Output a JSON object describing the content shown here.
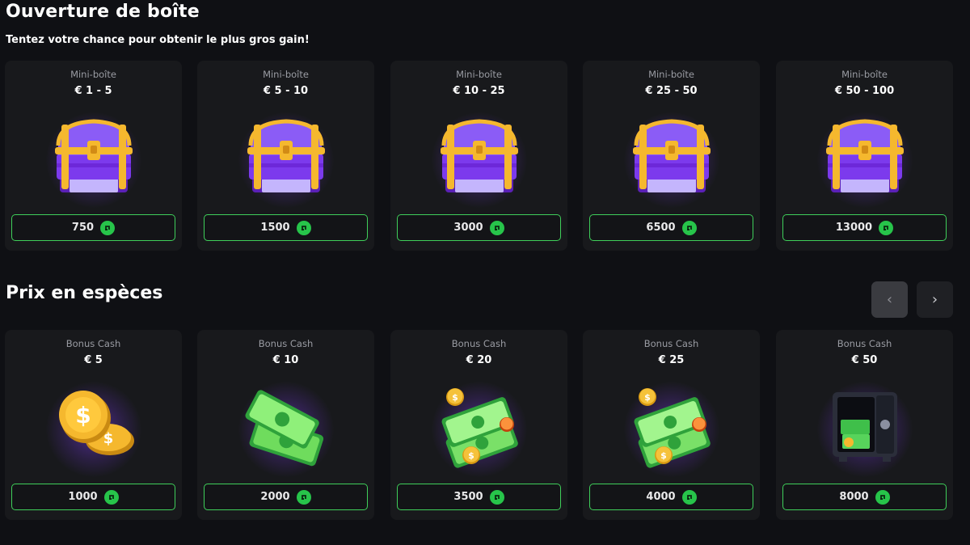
{
  "sections": {
    "boxes": {
      "title": "Ouverture de boîte",
      "subtitle": "Tentez votre chance pour obtenir le plus gros gain!",
      "cards": [
        {
          "category": "Mini-boîte",
          "amount": "€ 1 - 5",
          "price": "750",
          "icon": "treasure-chest"
        },
        {
          "category": "Mini-boîte",
          "amount": "€ 5 - 10",
          "price": "1500",
          "icon": "treasure-chest"
        },
        {
          "category": "Mini-boîte",
          "amount": "€ 10 - 25",
          "price": "3000",
          "icon": "treasure-chest"
        },
        {
          "category": "Mini-boîte",
          "amount": "€ 25 - 50",
          "price": "6500",
          "icon": "treasure-chest"
        },
        {
          "category": "Mini-boîte",
          "amount": "€ 50 - 100",
          "price": "13000",
          "icon": "treasure-chest"
        }
      ]
    },
    "cash": {
      "title": "Prix en espèces",
      "nav": {
        "prev": "‹",
        "next": "›"
      },
      "cards": [
        {
          "category": "Bonus Cash",
          "amount": "€ 5",
          "price": "1000",
          "icon": "gold-coins"
        },
        {
          "category": "Bonus Cash",
          "amount": "€ 10",
          "price": "2000",
          "icon": "banknotes"
        },
        {
          "category": "Bonus Cash",
          "amount": "€ 20",
          "price": "3500",
          "icon": "banknotes-coins"
        },
        {
          "category": "Bonus Cash",
          "amount": "€ 25",
          "price": "4000",
          "icon": "banknotes-coins"
        },
        {
          "category": "Bonus Cash",
          "amount": "€ 50",
          "price": "8000",
          "icon": "money-safe"
        }
      ]
    }
  },
  "colors": {
    "accent": "#3fcf5a",
    "card": "#18191c",
    "background": "#0f1014",
    "chest": "#7c3aed",
    "gold": "#f5b82e"
  }
}
